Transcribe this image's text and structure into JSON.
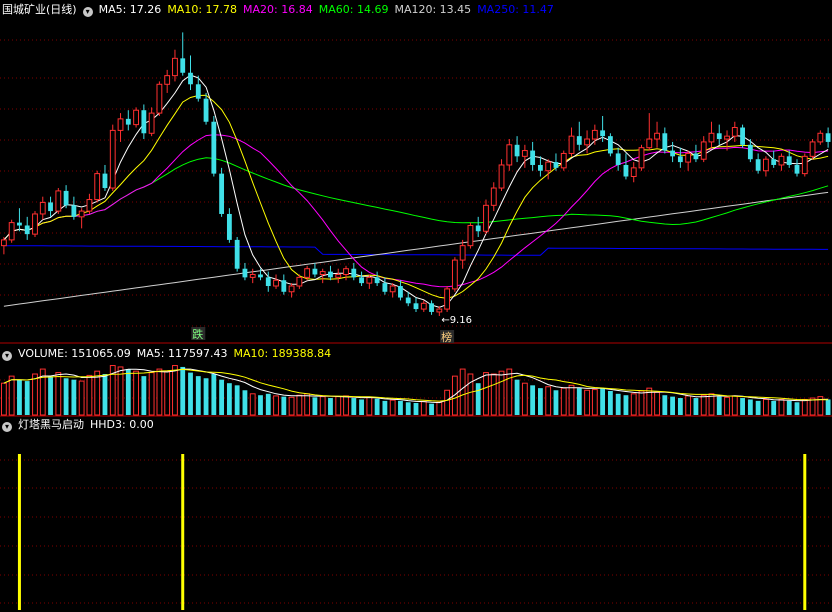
{
  "main_header": {
    "title": "国城矿业(日线)",
    "items": [
      {
        "text": "MA5: 17.26",
        "color": "#ffffff"
      },
      {
        "text": "MA10: 17.78",
        "color": "#ffff00"
      },
      {
        "text": "MA20: 16.84",
        "color": "#ff00ff"
      },
      {
        "text": "MA60: 14.69",
        "color": "#00ff00"
      },
      {
        "text": "MA120: 13.45",
        "color": "#d0d0d0"
      },
      {
        "text": "MA250: 11.47",
        "color": "#0000ff"
      }
    ]
  },
  "volume_header": {
    "items": [
      {
        "text": "VOLUME: 151065.09",
        "color": "#ffffff"
      },
      {
        "text": "MA5: 117597.43",
        "color": "#ffffff"
      },
      {
        "text": "MA10: 189388.84",
        "color": "#ffff00"
      }
    ]
  },
  "indicator_header": {
    "title": "灯塔黑马启动",
    "items": [
      {
        "text": "HHD3: 0.00",
        "color": "#ffffff"
      }
    ]
  },
  "annotations": {
    "low_price": "9.16",
    "mark_die": "跌",
    "mark_bang": "榜"
  },
  "colors": {
    "up": "#ff3030",
    "down": "#40e0e8",
    "grid": "#800000",
    "signal": "#ffff00"
  },
  "chart_data": [
    {
      "type": "candlestick",
      "title": "国城矿业(日线)",
      "ylim": [
        8.5,
        19.5
      ],
      "grid": true,
      "candles_ohlc": [
        [
          11.6,
          11.9,
          11.3,
          11.8
        ],
        [
          11.8,
          12.5,
          11.7,
          12.4
        ],
        [
          12.4,
          12.9,
          12.1,
          12.3
        ],
        [
          12.3,
          12.6,
          11.8,
          12.0
        ],
        [
          12.0,
          12.8,
          11.9,
          12.7
        ],
        [
          12.7,
          13.3,
          12.5,
          13.1
        ],
        [
          13.1,
          13.3,
          12.6,
          12.8
        ],
        [
          12.8,
          13.6,
          12.7,
          13.5
        ],
        [
          13.5,
          13.7,
          12.9,
          13.0
        ],
        [
          13.0,
          13.3,
          12.5,
          12.6
        ],
        [
          12.6,
          12.9,
          12.2,
          12.8
        ],
        [
          12.8,
          13.4,
          12.7,
          13.2
        ],
        [
          13.2,
          14.2,
          13.1,
          14.1
        ],
        [
          14.1,
          14.4,
          13.5,
          13.6
        ],
        [
          13.6,
          15.8,
          13.5,
          15.6
        ],
        [
          15.6,
          16.2,
          15.2,
          16.0
        ],
        [
          16.0,
          16.3,
          15.6,
          15.8
        ],
        [
          15.8,
          16.4,
          15.7,
          16.3
        ],
        [
          16.3,
          16.5,
          15.3,
          15.5
        ],
        [
          15.5,
          16.4,
          15.4,
          16.2
        ],
        [
          16.2,
          17.3,
          16.1,
          17.2
        ],
        [
          17.2,
          17.7,
          16.9,
          17.5
        ],
        [
          17.5,
          18.4,
          17.3,
          18.1
        ],
        [
          18.1,
          19.0,
          17.5,
          17.6
        ],
        [
          17.6,
          18.2,
          17.0,
          17.2
        ],
        [
          17.2,
          17.5,
          16.6,
          16.7
        ],
        [
          16.7,
          16.9,
          15.8,
          15.9
        ],
        [
          15.9,
          16.1,
          14.0,
          14.1
        ],
        [
          14.1,
          14.3,
          12.6,
          12.7
        ],
        [
          12.7,
          12.9,
          11.7,
          11.8
        ],
        [
          11.8,
          11.9,
          10.7,
          10.8
        ],
        [
          10.8,
          11.0,
          10.4,
          10.5
        ],
        [
          10.5,
          10.8,
          10.3,
          10.6
        ],
        [
          10.6,
          10.8,
          10.4,
          10.5
        ],
        [
          10.5,
          10.7,
          10.0,
          10.2
        ],
        [
          10.2,
          10.6,
          10.1,
          10.4
        ],
        [
          10.4,
          10.6,
          9.9,
          10.0
        ],
        [
          10.0,
          10.3,
          9.8,
          10.2
        ],
        [
          10.2,
          10.6,
          10.1,
          10.5
        ],
        [
          10.5,
          10.9,
          10.4,
          10.8
        ],
        [
          10.8,
          11.0,
          10.5,
          10.6
        ],
        [
          10.6,
          10.8,
          10.3,
          10.7
        ],
        [
          10.7,
          10.9,
          10.4,
          10.5
        ],
        [
          10.5,
          10.8,
          10.3,
          10.6
        ],
        [
          10.6,
          10.9,
          10.4,
          10.8
        ],
        [
          10.8,
          11.0,
          10.4,
          10.5
        ],
        [
          10.5,
          10.7,
          10.2,
          10.3
        ],
        [
          10.3,
          10.6,
          10.1,
          10.5
        ],
        [
          10.5,
          10.7,
          10.2,
          10.3
        ],
        [
          10.3,
          10.5,
          9.9,
          10.0
        ],
        [
          10.0,
          10.3,
          9.8,
          10.2
        ],
        [
          10.2,
          10.4,
          9.7,
          9.8
        ],
        [
          9.8,
          10.0,
          9.5,
          9.6
        ],
        [
          9.6,
          9.8,
          9.3,
          9.4
        ],
        [
          9.4,
          9.7,
          9.3,
          9.6
        ],
        [
          9.6,
          9.7,
          9.2,
          9.3
        ],
        [
          9.3,
          9.5,
          9.16,
          9.4
        ],
        [
          9.4,
          10.2,
          9.3,
          10.1
        ],
        [
          10.1,
          11.2,
          10.0,
          11.1
        ],
        [
          11.1,
          11.8,
          10.8,
          11.6
        ],
        [
          11.6,
          12.4,
          11.5,
          12.3
        ],
        [
          12.3,
          12.6,
          11.9,
          12.1
        ],
        [
          12.1,
          13.2,
          12.0,
          13.0
        ],
        [
          13.0,
          13.8,
          12.8,
          13.6
        ],
        [
          13.6,
          14.6,
          13.5,
          14.4
        ],
        [
          14.4,
          15.3,
          14.2,
          15.1
        ],
        [
          15.1,
          15.4,
          14.5,
          14.7
        ],
        [
          14.7,
          15.1,
          14.3,
          14.9
        ],
        [
          14.9,
          15.2,
          14.2,
          14.4
        ],
        [
          14.4,
          14.7,
          14.0,
          14.2
        ],
        [
          14.2,
          14.6,
          13.9,
          14.5
        ],
        [
          14.5,
          14.8,
          14.2,
          14.3
        ],
        [
          14.3,
          14.9,
          14.2,
          14.8
        ],
        [
          14.8,
          15.7,
          14.7,
          15.4
        ],
        [
          15.4,
          15.9,
          14.9,
          15.1
        ],
        [
          15.1,
          15.6,
          14.8,
          15.3
        ],
        [
          15.3,
          15.8,
          15.1,
          15.6
        ],
        [
          15.6,
          16.1,
          15.2,
          15.4
        ],
        [
          15.4,
          15.5,
          14.7,
          14.8
        ],
        [
          14.8,
          15.0,
          14.2,
          14.4
        ],
        [
          14.4,
          14.8,
          13.9,
          14.0
        ],
        [
          14.0,
          14.5,
          13.8,
          14.3
        ],
        [
          14.3,
          15.1,
          14.2,
          15.0
        ],
        [
          15.0,
          16.2,
          14.9,
          15.3
        ],
        [
          15.3,
          15.9,
          15.0,
          15.5
        ],
        [
          15.5,
          15.7,
          14.8,
          14.9
        ],
        [
          14.9,
          15.2,
          14.5,
          14.7
        ],
        [
          14.7,
          15.0,
          14.3,
          14.5
        ],
        [
          14.5,
          14.9,
          14.2,
          14.8
        ],
        [
          14.8,
          15.1,
          14.5,
          14.6
        ],
        [
          14.6,
          15.4,
          14.5,
          15.2
        ],
        [
          15.2,
          15.9,
          15.0,
          15.5
        ],
        [
          15.5,
          15.8,
          15.1,
          15.3
        ],
        [
          15.3,
          15.6,
          14.9,
          15.4
        ],
        [
          15.4,
          15.9,
          15.2,
          15.7
        ],
        [
          15.7,
          15.8,
          15.0,
          15.1
        ],
        [
          15.1,
          15.3,
          14.5,
          14.6
        ],
        [
          14.6,
          14.8,
          14.1,
          14.2
        ],
        [
          14.2,
          14.7,
          14.0,
          14.6
        ],
        [
          14.6,
          14.9,
          14.3,
          14.4
        ],
        [
          14.4,
          14.8,
          14.2,
          14.7
        ],
        [
          14.7,
          14.9,
          14.3,
          14.4
        ],
        [
          14.4,
          14.6,
          14.0,
          14.1
        ],
        [
          14.1,
          14.8,
          14.0,
          14.7
        ],
        [
          14.7,
          15.3,
          14.6,
          15.2
        ],
        [
          15.2,
          15.6,
          15.1,
          15.5
        ],
        [
          15.5,
          15.7,
          15.0,
          15.2
        ]
      ]
    },
    {
      "type": "bar",
      "title": "VOLUME",
      "values": [
        0.45,
        0.55,
        0.5,
        0.48,
        0.58,
        0.65,
        0.55,
        0.6,
        0.52,
        0.5,
        0.48,
        0.56,
        0.62,
        0.58,
        0.7,
        0.68,
        0.65,
        0.62,
        0.55,
        0.6,
        0.65,
        0.62,
        0.7,
        0.68,
        0.6,
        0.55,
        0.52,
        0.58,
        0.5,
        0.45,
        0.42,
        0.35,
        0.3,
        0.28,
        0.3,
        0.27,
        0.26,
        0.25,
        0.28,
        0.3,
        0.25,
        0.26,
        0.24,
        0.26,
        0.27,
        0.24,
        0.22,
        0.25,
        0.23,
        0.2,
        0.21,
        0.2,
        0.18,
        0.17,
        0.19,
        0.16,
        0.18,
        0.35,
        0.55,
        0.65,
        0.58,
        0.45,
        0.6,
        0.58,
        0.62,
        0.65,
        0.5,
        0.45,
        0.42,
        0.38,
        0.4,
        0.35,
        0.38,
        0.42,
        0.38,
        0.35,
        0.36,
        0.38,
        0.34,
        0.3,
        0.28,
        0.3,
        0.34,
        0.38,
        0.32,
        0.28,
        0.26,
        0.24,
        0.27,
        0.24,
        0.28,
        0.3,
        0.26,
        0.25,
        0.27,
        0.24,
        0.22,
        0.2,
        0.22,
        0.2,
        0.22,
        0.2,
        0.18,
        0.22,
        0.24,
        0.26,
        0.22
      ]
    },
    {
      "type": "bar",
      "title": "灯塔黑马启动",
      "signal_indices": [
        2,
        23,
        103
      ]
    }
  ]
}
